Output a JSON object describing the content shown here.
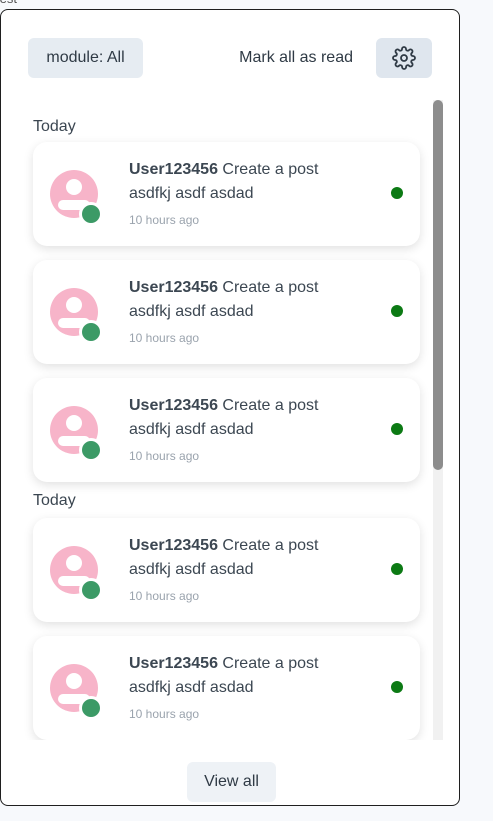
{
  "page": {
    "fragment_text": "test"
  },
  "header": {
    "module_label": "module: All",
    "mark_all_label": "Mark all as read",
    "settings_icon": "gear-icon"
  },
  "groups": [
    {
      "label": "Today",
      "items": [
        {
          "user": "User123456",
          "action": "Create a post",
          "body": "asdfkj asdf asdad",
          "time": "10 hours ago",
          "unread": true
        },
        {
          "user": "User123456",
          "action": "Create a post",
          "body": "asdfkj asdf asdad",
          "time": "10 hours ago",
          "unread": true
        },
        {
          "user": "User123456",
          "action": "Create a post",
          "body": "asdfkj asdf asdad",
          "time": "10 hours ago",
          "unread": true
        }
      ]
    },
    {
      "label": "Today",
      "items": [
        {
          "user": "User123456",
          "action": "Create a post",
          "body": "asdfkj asdf asdad",
          "time": "10 hours ago",
          "unread": true
        },
        {
          "user": "User123456",
          "action": "Create a post",
          "body": "asdfkj asdf asdad",
          "time": "10 hours ago",
          "unread": true
        }
      ]
    }
  ],
  "footer": {
    "view_all_label": "View all"
  },
  "colors": {
    "avatar": "#f7b4c9",
    "online": "#3c9a66",
    "unread": "#0c7a14"
  }
}
